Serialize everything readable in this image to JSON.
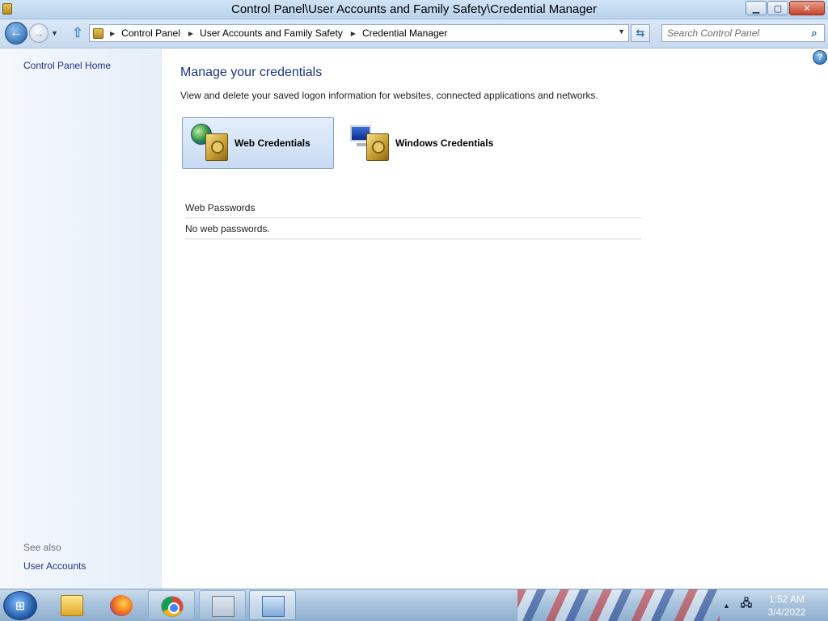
{
  "window": {
    "title": "Control Panel\\User Accounts and Family Safety\\Credential Manager",
    "minimize_glyph": "▁",
    "maximize_glyph": "▢",
    "close_glyph": "✕"
  },
  "navbar": {
    "breadcrumb": [
      "Control Panel",
      "User Accounts and Family Safety",
      "Credential Manager"
    ],
    "search_placeholder": "Search Control Panel"
  },
  "sidebar": {
    "home_link": "Control Panel Home",
    "see_also_label": "See also",
    "see_also_links": [
      "User Accounts"
    ]
  },
  "main": {
    "heading": "Manage your credentials",
    "description": "View and delete your saved logon information for websites, connected applications and networks.",
    "tiles": [
      {
        "label": "Web Credentials",
        "selected": true
      },
      {
        "label": "Windows Credentials",
        "selected": false
      }
    ],
    "web_passwords_header": "Web Passwords",
    "web_passwords_empty": "No web passwords."
  },
  "taskbar": {
    "items": [
      {
        "icon": "folder-icon",
        "state": "pinned"
      },
      {
        "icon": "firefox-icon",
        "state": "pinned"
      },
      {
        "icon": "chrome-icon",
        "state": "open"
      },
      {
        "icon": "performance-monitor-icon",
        "state": "open"
      },
      {
        "icon": "control-panel-icon",
        "state": "active"
      }
    ],
    "clock_time": "1:52 AM",
    "clock_date": "3/4/2022"
  },
  "colors": {
    "link_blue": "#1e3287",
    "heading_blue": "#1e3287",
    "selected_tile": "#c8dbf3"
  }
}
